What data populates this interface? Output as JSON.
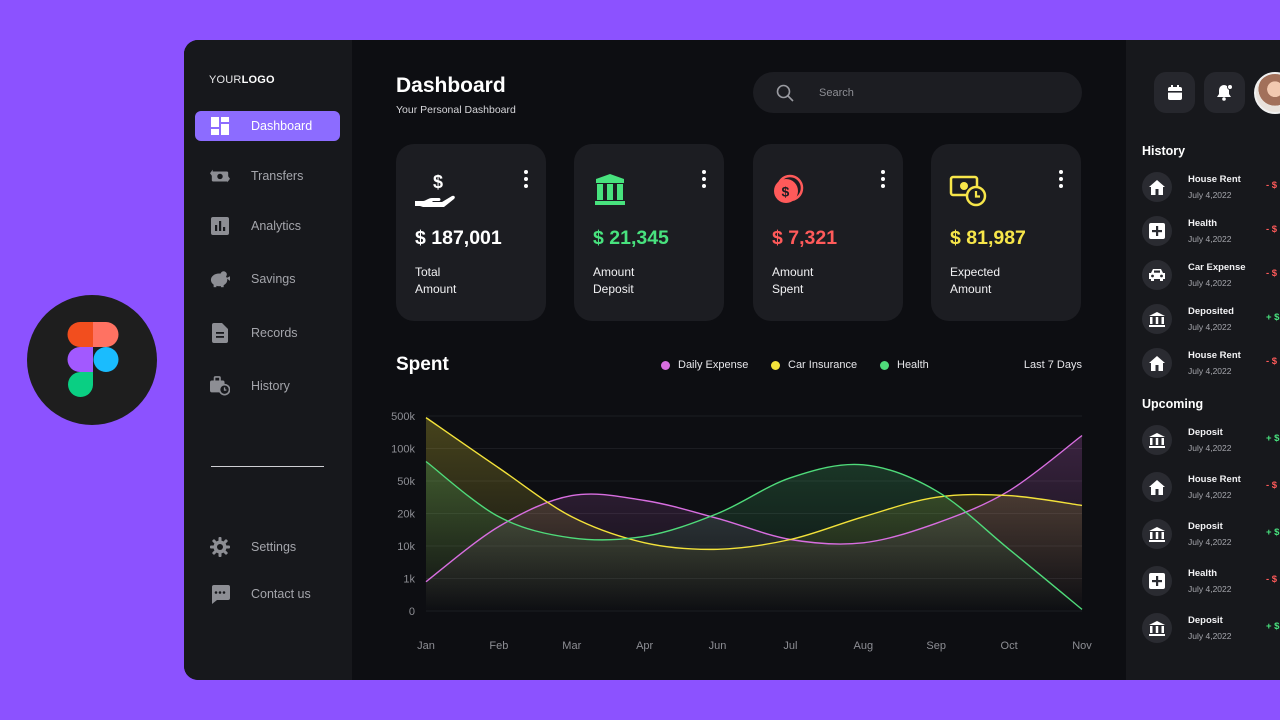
{
  "logo": {
    "prefix": "YOUR",
    "bold": "LOGO"
  },
  "nav": [
    {
      "label": "Dashboard",
      "icon": "grid-icon",
      "active": true
    },
    {
      "label": "Transfers",
      "icon": "money-transfer-icon"
    },
    {
      "label": "Analytics",
      "icon": "bar-chart-icon"
    },
    {
      "label": "Savings",
      "icon": "piggy-bank-icon"
    },
    {
      "label": "Records",
      "icon": "document-icon"
    },
    {
      "label": "History",
      "icon": "briefcase-clock-icon"
    }
  ],
  "nav_bottom": [
    {
      "label": "Settings",
      "icon": "gear-icon"
    },
    {
      "label": "Contact us",
      "icon": "chat-icon"
    }
  ],
  "header": {
    "title": "Dashboard",
    "subtitle": "Your Personal Dashboard"
  },
  "search": {
    "placeholder": "Search"
  },
  "cards": [
    {
      "value": "$ 187,001",
      "label_line1": "Total",
      "label_line2": "Amount",
      "color": "#ffffff",
      "icon": "hand-dollar-icon"
    },
    {
      "value": "$ 21,345",
      "label_line1": "Amount",
      "label_line2": "Deposit",
      "color": "#48e27e",
      "icon": "bank-icon"
    },
    {
      "value": "$ 7,321",
      "label_line1": "Amount",
      "label_line2": "Spent",
      "color": "#ff5a5a",
      "icon": "coins-icon"
    },
    {
      "value": "$ 81,987",
      "label_line1": "Expected",
      "label_line2": "Amount",
      "color": "#f7e64a",
      "icon": "cash-clock-icon"
    }
  ],
  "spent": {
    "title": "Spent",
    "legend": [
      {
        "name": "Daily Expense",
        "color": "#d86ee0"
      },
      {
        "name": "Car Insurance",
        "color": "#f3e23a"
      },
      {
        "name": "Health",
        "color": "#4fdb7a"
      }
    ],
    "range": "Last 7 Days"
  },
  "chart_data": {
    "type": "area",
    "categories": [
      "Jan",
      "Feb",
      "Mar",
      "Apr",
      "Jun",
      "Jul",
      "Aug",
      "Sep",
      "Oct",
      "Nov"
    ],
    "y_ticks": [
      "500k",
      "100k",
      "50k",
      "20k",
      "10k",
      "1k",
      "0"
    ],
    "y_scale": "categorical-log",
    "grid": true,
    "series": [
      {
        "name": "Daily Expense",
        "color": "#d86ee0",
        "values": [
          0.9,
          2.6,
          3.55,
          3.4,
          2.85,
          2.2,
          2.1,
          2.7,
          3.7,
          5.4
        ]
      },
      {
        "name": "Car Insurance",
        "color": "#f3e23a",
        "values": [
          5.95,
          4.4,
          2.9,
          2.1,
          1.9,
          2.2,
          2.9,
          3.5,
          3.55,
          3.25
        ]
      },
      {
        "name": "Health",
        "color": "#4fdb7a",
        "values": [
          4.6,
          2.9,
          2.25,
          2.3,
          3.0,
          4.1,
          4.5,
          3.7,
          1.9,
          0.05
        ]
      }
    ]
  },
  "history": {
    "title": "History",
    "items": [
      {
        "name": "House Rent",
        "date": "July 4,2022",
        "amount": "- $",
        "type": "neg",
        "icon": "house-icon"
      },
      {
        "name": "Health",
        "date": "July 4,2022",
        "amount": "- $",
        "type": "neg",
        "icon": "medical-cross-icon"
      },
      {
        "name": "Car Expense",
        "date": "July 4,2022",
        "amount": "- $",
        "type": "neg",
        "icon": "car-icon"
      },
      {
        "name": "Deposited",
        "date": "July 4,2022",
        "amount": "+ $",
        "type": "pos",
        "icon": "bank-icon"
      },
      {
        "name": "House Rent",
        "date": "July 4,2022",
        "amount": "- $",
        "type": "neg",
        "icon": "house-icon"
      }
    ]
  },
  "upcoming": {
    "title": "Upcoming",
    "items": [
      {
        "name": "Deposit",
        "date": "July 4,2022",
        "amount": "+ $",
        "type": "pos",
        "icon": "bank-icon"
      },
      {
        "name": "House Rent",
        "date": "July 4,2022",
        "amount": "- $",
        "type": "neg",
        "icon": "house-icon"
      },
      {
        "name": "Deposit",
        "date": "July 4,2022",
        "amount": "+ $",
        "type": "pos",
        "icon": "bank-icon"
      },
      {
        "name": "Health",
        "date": "July 4,2022",
        "amount": "- $",
        "type": "neg",
        "icon": "medical-cross-icon"
      },
      {
        "name": "Deposit",
        "date": "July 4,2022",
        "amount": "+ $",
        "type": "pos",
        "icon": "bank-icon"
      }
    ]
  },
  "colors": {
    "accent": "#8c6cff",
    "background": "#8c52ff",
    "positive": "#48e27e",
    "negative": "#ff5a5a"
  }
}
